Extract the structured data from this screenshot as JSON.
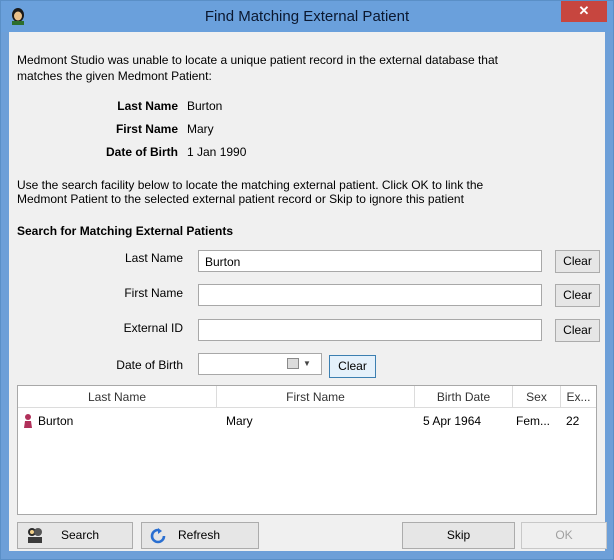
{
  "window": {
    "title": "Find Matching External Patient",
    "close_label": "✕",
    "app_icon": "patient-head-icon"
  },
  "intro": {
    "line1": "Medmont Studio was unable to locate a unique patient record in the external database that",
    "line2": "matches the given Medmont Patient:"
  },
  "patient": {
    "last_name_label": "Last Name",
    "last_name": "Burton",
    "first_name_label": "First Name",
    "first_name": "Mary",
    "dob_label": "Date of Birth",
    "dob": "1 Jan 1990"
  },
  "instructions": {
    "line1": "Use the search facility below to locate the matching external patient.  Click OK to link the",
    "line2": "Medmont Patient to the selected external patient record or Skip to ignore this patient"
  },
  "search": {
    "heading": "Search for Matching External Patients",
    "last_name_label": "Last Name",
    "last_name_value": "Burton",
    "first_name_label": "First Name",
    "first_name_value": "",
    "external_id_label": "External ID",
    "external_id_value": "",
    "dob_label": "Date of Birth",
    "dob_value": "",
    "clear_label": "Clear"
  },
  "results": {
    "columns": [
      "Last Name",
      "First Name",
      "Birth Date",
      "Sex",
      "Ex..."
    ],
    "rows": [
      {
        "last_name": "Burton",
        "first_name": "Mary",
        "birth_date": "5 Apr 1964",
        "sex": "Fem...",
        "ext": "22"
      }
    ]
  },
  "footer": {
    "search_label": "Search",
    "refresh_label": "Refresh",
    "skip_label": "Skip",
    "ok_label": "OK"
  },
  "colors": {
    "titlebar": "#6aa0dc",
    "close": "#c7463f",
    "refresh_icon": "#2a6fd1",
    "female_icon": "#b0305a"
  }
}
